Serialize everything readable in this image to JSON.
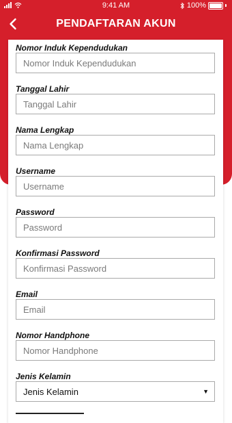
{
  "status_bar": {
    "time": "9:41 AM",
    "battery": "100%"
  },
  "header": {
    "title": "PENDAFTARAN AKUN",
    "back_icon": "chevron-left-icon"
  },
  "colors": {
    "brand_red": "#d51f2b"
  },
  "form": {
    "fields": [
      {
        "label": "Nomor Induk Kependudukan",
        "placeholder": "Nomor Induk Kependudukan"
      },
      {
        "label": "Tanggal Lahir",
        "placeholder": "Tanggal Lahir"
      },
      {
        "label": "Nama Lengkap",
        "placeholder": "Nama Lengkap"
      },
      {
        "label": "Username",
        "placeholder": "Username"
      },
      {
        "label": "Password",
        "placeholder": "Password"
      },
      {
        "label": "Konfirmasi Password",
        "placeholder": "Konfirmasi Password"
      },
      {
        "label": "Email",
        "placeholder": "Email"
      },
      {
        "label": "Nomor Handphone",
        "placeholder": "Nomor Handphone"
      }
    ],
    "gender": {
      "label": "Jenis Kelamin",
      "value": "Jenis Kelamin"
    }
  }
}
